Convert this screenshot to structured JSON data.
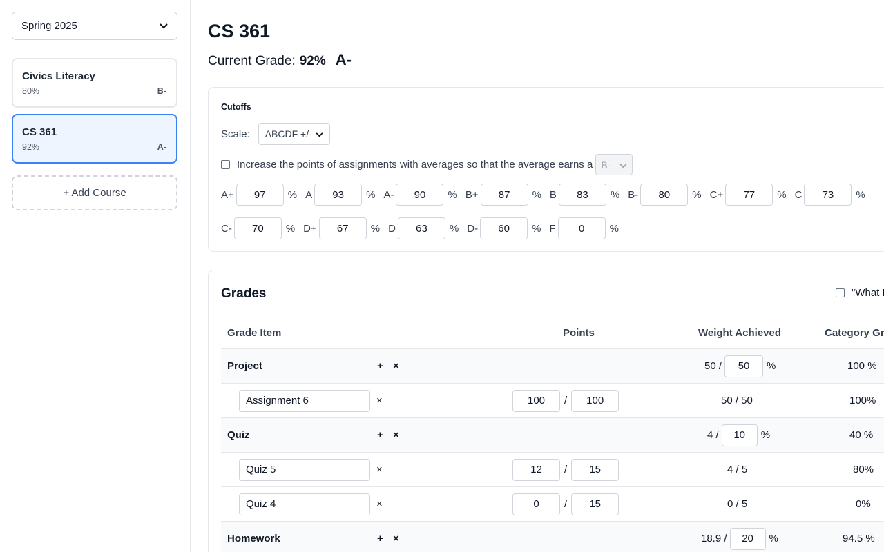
{
  "sidebar": {
    "term": "Spring 2025",
    "courses": [
      {
        "name": "Civics Literacy",
        "percent": "80%",
        "letter": "B-"
      },
      {
        "name": "CS 361",
        "percent": "92%",
        "letter": "A-"
      }
    ],
    "add_course_label": "+ Add Course"
  },
  "main": {
    "title": "CS 361",
    "current_grade_label": "Current Grade:",
    "current_grade_percent": "92%",
    "current_grade_letter": "A-"
  },
  "cutoffs": {
    "title": "Cutoffs",
    "scale_label": "Scale:",
    "scale_value": "ABCDF +/-",
    "increase_label": "Increase the points of assignments with averages so that the average earns a",
    "increase_value": "B-",
    "percent_sign": "%",
    "rows": [
      [
        {
          "grade": "A+",
          "value": "97"
        },
        {
          "grade": "A",
          "value": "93"
        },
        {
          "grade": "A-",
          "value": "90"
        },
        {
          "grade": "B+",
          "value": "87"
        },
        {
          "grade": "B",
          "value": "83"
        },
        {
          "grade": "B-",
          "value": "80"
        },
        {
          "grade": "C+",
          "value": "77"
        },
        {
          "grade": "C",
          "value": "73"
        }
      ],
      [
        {
          "grade": "C-",
          "value": "70"
        },
        {
          "grade": "D+",
          "value": "67"
        },
        {
          "grade": "D",
          "value": "63"
        },
        {
          "grade": "D-",
          "value": "60"
        },
        {
          "grade": "F",
          "value": "0"
        }
      ]
    ]
  },
  "grades": {
    "title": "Grades",
    "what_if_label": "\"What I",
    "columns": {
      "item": "Grade Item",
      "points": "Points",
      "weight": "Weight Achieved",
      "category": "Category Gra"
    },
    "plus_glyph": "+",
    "x_glyph": "×",
    "slash": "/",
    "percent_sign": "%",
    "categories": [
      {
        "name": "Project",
        "achieved": "50 /",
        "weight": "50",
        "category_grade": "100 %",
        "items": [
          {
            "name": "Assignment 6",
            "earned": "100",
            "possible": "100",
            "weight": "50 / 50",
            "grade": "100%"
          }
        ]
      },
      {
        "name": "Quiz",
        "achieved": "4 /",
        "weight": "10",
        "category_grade": "40 %",
        "items": [
          {
            "name": "Quiz 5",
            "earned": "12",
            "possible": "15",
            "weight": "4 / 5",
            "grade": "80%"
          },
          {
            "name": "Quiz 4",
            "earned": "0",
            "possible": "15",
            "weight": "0 / 5",
            "grade": "0%"
          }
        ]
      },
      {
        "name": "Homework",
        "achieved": "18.9 /",
        "weight": "20",
        "category_grade": "94.5 %",
        "items": []
      }
    ]
  }
}
